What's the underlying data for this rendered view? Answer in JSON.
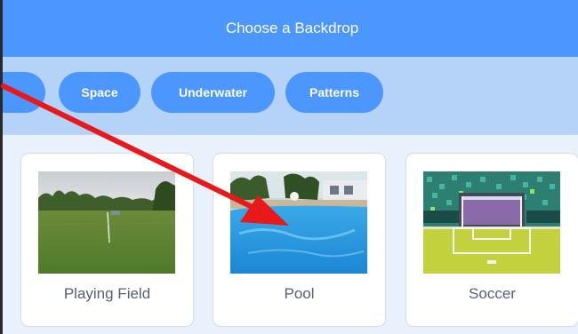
{
  "header": {
    "title": "Choose a Backdrop"
  },
  "filters": [
    {
      "label": ""
    },
    {
      "label": "Space"
    },
    {
      "label": "Underwater"
    },
    {
      "label": "Patterns"
    }
  ],
  "backdrops": [
    {
      "name": "Playing Field"
    },
    {
      "name": "Pool"
    },
    {
      "name": "Soccer"
    }
  ],
  "annotation": {
    "arrow_color": "#e8191b"
  },
  "colors": {
    "accent": "#4c97ff",
    "filter_bar": "#b5d2f9",
    "background": "#e9f1fc"
  }
}
